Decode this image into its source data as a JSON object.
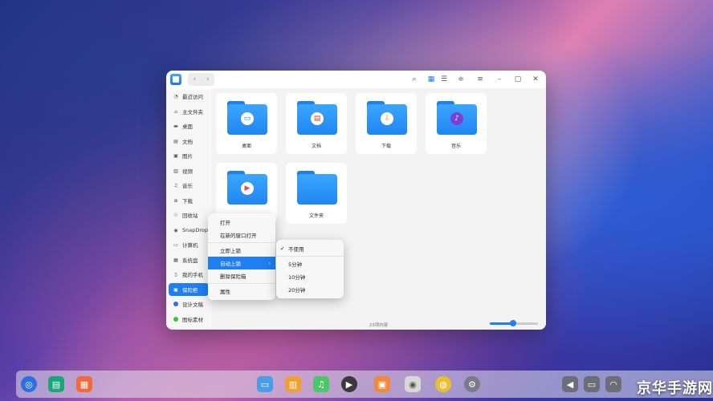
{
  "window": {
    "nav_back": "‹",
    "nav_forward": "›",
    "toolbar_icons": [
      "search-icon",
      "grid-view-icon",
      "list-view-icon",
      "sort-icon",
      "menu-icon",
      "minimize-icon",
      "maximize-icon",
      "close-icon"
    ]
  },
  "sidebar": {
    "items": [
      {
        "label": "最近访问",
        "icon": "recent-icon"
      },
      {
        "label": "主文件夹",
        "icon": "home-icon"
      },
      {
        "label": "桌面",
        "icon": "desktop-icon"
      },
      {
        "label": "文档",
        "icon": "documents-icon"
      },
      {
        "label": "图片",
        "icon": "pictures-icon"
      },
      {
        "label": "视频",
        "icon": "videos-icon"
      },
      {
        "label": "音乐",
        "icon": "music-icon"
      },
      {
        "label": "下载",
        "icon": "downloads-icon"
      },
      {
        "label": "回收站",
        "icon": "trash-icon"
      },
      {
        "label": "SnapDrop",
        "icon": "snapdrop-icon"
      },
      {
        "label": "计算机",
        "icon": "computer-icon"
      },
      {
        "label": "系统盘",
        "icon": "disk-icon"
      },
      {
        "label": "我的手机",
        "icon": "phone-icon"
      },
      {
        "label": "保险柜",
        "icon": "vault-icon",
        "selected": true
      },
      {
        "label": "设计文稿",
        "icon": "tag-blue-icon",
        "color": "#2f6fe8"
      },
      {
        "label": "图标素材",
        "icon": "tag-green-icon",
        "color": "#3ec23e"
      }
    ]
  },
  "files": [
    {
      "label": "桌面",
      "glyph": "▭"
    },
    {
      "label": "文档",
      "glyph": "▤"
    },
    {
      "label": "下载",
      "glyph": "⇩"
    },
    {
      "label": "音乐",
      "glyph": "♪"
    },
    {
      "label": "",
      "glyph": "▶"
    },
    {
      "label": "文件夹",
      "glyph": ""
    }
  ],
  "status": {
    "text": "23项内容"
  },
  "context_menu": {
    "items": [
      "打开",
      "在新的窗口打开",
      "立即上锁",
      "自动上锁",
      "删除保险箱",
      "属性"
    ]
  },
  "submenu": {
    "items": [
      "不使用",
      "5分钟",
      "10分钟",
      "20分钟"
    ],
    "checked": "不使用"
  },
  "zoom_level": 0.9,
  "watermark": "京华手游网",
  "colors": {
    "accent": "#1f7ef0"
  }
}
